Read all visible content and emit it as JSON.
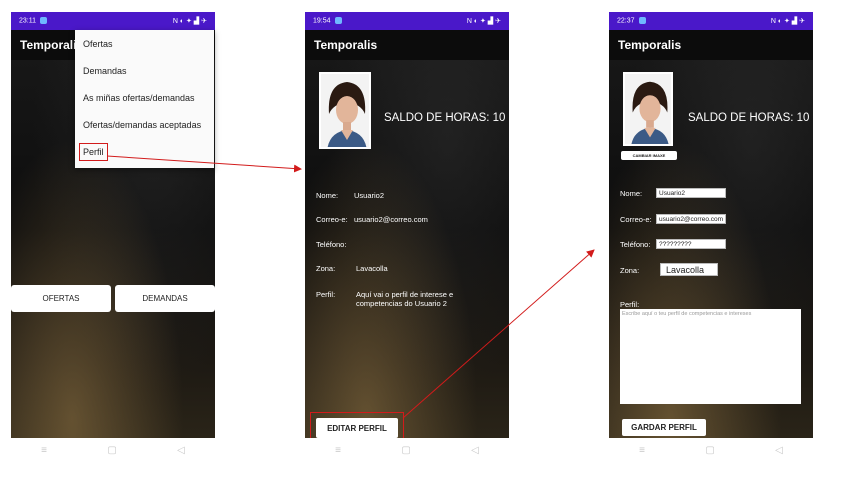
{
  "app_title": "Temporalis",
  "screens": [
    {
      "status_time": "23:11",
      "status_icons": "N ◐ ✦ ▟ ✈",
      "menu": [
        "Ofertas",
        "Demandas",
        "As miñas ofertas/demandas",
        "Ofertas/demandas aceptadas",
        "Perfil"
      ],
      "buttons": {
        "ofertas": "OFERTAS",
        "demandas": "DEMANDAS"
      }
    },
    {
      "status_time": "19:54",
      "status_icons": "N ◐ ✦ ▟ ✈",
      "saldo": "SALDO DE HORAS: 10",
      "fields": [
        {
          "label": "Nome:",
          "value": "Usuario2"
        },
        {
          "label": "Correo-e:",
          "value": "usuario2@correo.com"
        },
        {
          "label": "Teléfono:",
          "value": ""
        },
        {
          "label": "Zona:",
          "value": "Lavacolla"
        },
        {
          "label": "Perfil:",
          "value": "Aquí vai o perfil de interese e competencias do Usuario 2"
        }
      ],
      "edit_button": "EDITAR PERFIL"
    },
    {
      "status_time": "22:37",
      "status_icons": "N ◐ ✦ ▟ ✈",
      "saldo": "SALDO DE HORAS: 10",
      "change_image_button": "CAMBIAR IMAXE",
      "fields": [
        {
          "label": "Nome:",
          "value": "Usuario2"
        },
        {
          "label": "Correo-e:",
          "value": "usuario2@correo.com"
        },
        {
          "label": "Teléfono:",
          "value": "?????????"
        },
        {
          "label": "Zona:",
          "value": "Lavacolla"
        }
      ],
      "perfil_label": "Perfil:",
      "perfil_placeholder": "Escribe aquí o teu perfil de competencias e intereses",
      "save_button": "GARDAR PERFIL"
    }
  ],
  "nav_icons": [
    "menu-icon",
    "home-square-icon",
    "back-triangle-icon"
  ],
  "colors": {
    "status_bar": "#4a18c9",
    "highlight": "#d21b1b",
    "app_bar": "#0c0c0c"
  }
}
